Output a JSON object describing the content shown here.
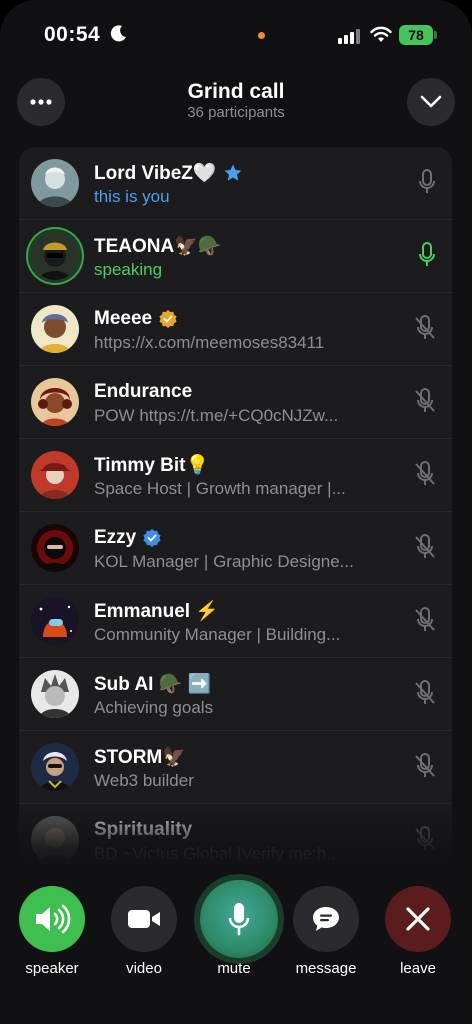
{
  "status_bar": {
    "time": "00:54",
    "battery": "78"
  },
  "header": {
    "title": "Grind call",
    "subtitle": "36 participants"
  },
  "participants": [
    {
      "name": "Lord VibeZ🤍",
      "status": "this is you",
      "avatar_color": "#9fb4b8"
    },
    {
      "name": "TEAONA🦅🪖",
      "status": "speaking",
      "avatar_color": "#3a3a2a"
    },
    {
      "name": "Meeee",
      "status": "https://x.com/meemoses83411",
      "avatar_color": "#d9b46a"
    },
    {
      "name": "Endurance",
      "status": "POW https://t.me/+CQ0cNJZw...",
      "avatar_color": "#a04a2a"
    },
    {
      "name": "Timmy Bit💡",
      "status": "Space Host | Growth manager |...",
      "avatar_color": "#b03a2a"
    },
    {
      "name": "Ezzy",
      "status": "KOL Manager | Graphic Designe...",
      "avatar_color": "#5a1010"
    },
    {
      "name": "Emmanuel ⚡",
      "status": "Community Manager | Building...",
      "avatar_color": "#2a1a3a"
    },
    {
      "name": "Sub AI 🪖 ➡️",
      "status": "Achieving goals",
      "avatar_color": "#cfcfcf"
    },
    {
      "name": "STORM🦅",
      "status": "Web3 builder",
      "avatar_color": "#2a3a5a"
    },
    {
      "name": "Spirituality",
      "status": "BD ~Victus Global |Verify me:h...",
      "avatar_color": "#555"
    }
  ],
  "controls": {
    "speaker": "speaker",
    "video": "video",
    "mute": "mute",
    "message": "message",
    "leave": "leave"
  },
  "colors": {
    "speaking_green": "#4ccf5f",
    "you_blue": "#4a9ff0",
    "speaker_btn": "#3fbf4f",
    "leave_btn": "#5a1c1c"
  }
}
